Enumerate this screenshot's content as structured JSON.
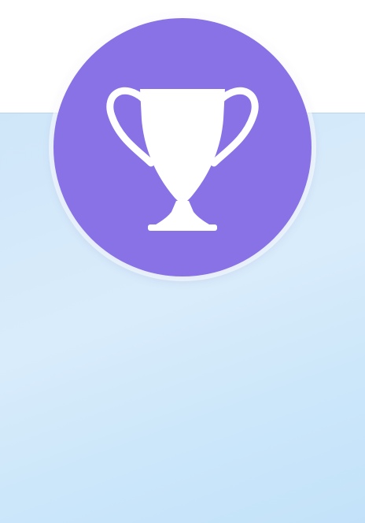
{
  "colors": {
    "accent": "#8872e6",
    "trophy": "#ffffff",
    "card_background": "#d3e9fa",
    "page_background": "#ffffff"
  },
  "icons": {
    "badge_icon": "trophy-icon"
  }
}
